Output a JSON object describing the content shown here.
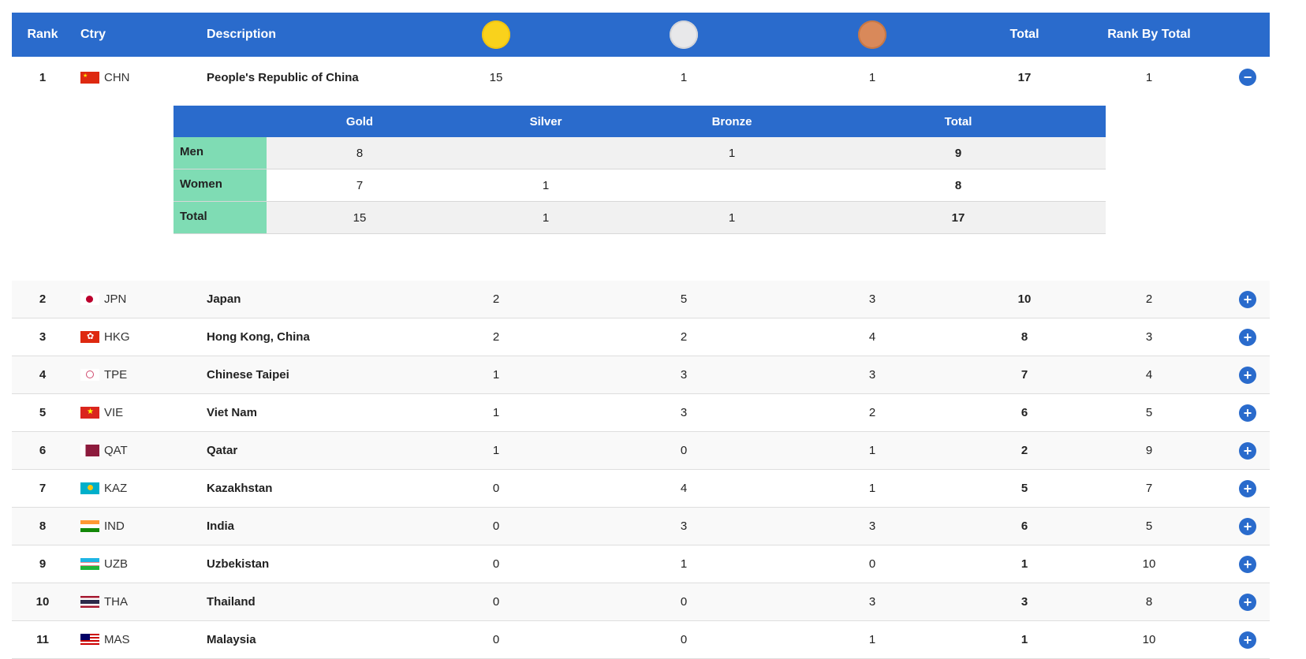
{
  "header": {
    "rank": "Rank",
    "ctry": "Ctry",
    "description": "Description",
    "total": "Total",
    "rank_by_total": "Rank By Total"
  },
  "sub_header": {
    "gold": "Gold",
    "silver": "Silver",
    "bronze": "Bronze",
    "total": "Total"
  },
  "first": {
    "rank": "1",
    "code": "CHN",
    "name": "People's Republic of China",
    "gold": "15",
    "silver": "1",
    "bronze": "1",
    "total": "17",
    "rank_by_total": "1",
    "breakdown": [
      {
        "label": "Men",
        "gold": "8",
        "silver": "",
        "bronze": "1",
        "total": "9"
      },
      {
        "label": "Women",
        "gold": "7",
        "silver": "1",
        "bronze": "",
        "total": "8"
      },
      {
        "label": "Total",
        "gold": "15",
        "silver": "1",
        "bronze": "1",
        "total": "17"
      }
    ]
  },
  "rows": [
    {
      "rank": "2",
      "code": "JPN",
      "name": "Japan",
      "gold": "2",
      "silver": "5",
      "bronze": "3",
      "total": "10",
      "rank_by_total": "2"
    },
    {
      "rank": "3",
      "code": "HKG",
      "name": "Hong Kong, China",
      "gold": "2",
      "silver": "2",
      "bronze": "4",
      "total": "8",
      "rank_by_total": "3"
    },
    {
      "rank": "4",
      "code": "TPE",
      "name": "Chinese Taipei",
      "gold": "1",
      "silver": "3",
      "bronze": "3",
      "total": "7",
      "rank_by_total": "4"
    },
    {
      "rank": "5",
      "code": "VIE",
      "name": "Viet Nam",
      "gold": "1",
      "silver": "3",
      "bronze": "2",
      "total": "6",
      "rank_by_total": "5"
    },
    {
      "rank": "6",
      "code": "QAT",
      "name": "Qatar",
      "gold": "1",
      "silver": "0",
      "bronze": "1",
      "total": "2",
      "rank_by_total": "9"
    },
    {
      "rank": "7",
      "code": "KAZ",
      "name": "Kazakhstan",
      "gold": "0",
      "silver": "4",
      "bronze": "1",
      "total": "5",
      "rank_by_total": "7"
    },
    {
      "rank": "8",
      "code": "IND",
      "name": "India",
      "gold": "0",
      "silver": "3",
      "bronze": "3",
      "total": "6",
      "rank_by_total": "5"
    },
    {
      "rank": "9",
      "code": "UZB",
      "name": "Uzbekistan",
      "gold": "0",
      "silver": "1",
      "bronze": "0",
      "total": "1",
      "rank_by_total": "10"
    },
    {
      "rank": "10",
      "code": "THA",
      "name": "Thailand",
      "gold": "0",
      "silver": "0",
      "bronze": "3",
      "total": "3",
      "rank_by_total": "8"
    },
    {
      "rank": "11",
      "code": "MAS",
      "name": "Malaysia",
      "gold": "0",
      "silver": "0",
      "bronze": "1",
      "total": "1",
      "rank_by_total": "10"
    }
  ],
  "icons": {
    "collapse": "minus-circle-icon",
    "expand": "plus-circle-icon"
  },
  "colors": {
    "header_bg": "#2a6bcc",
    "label_green": "#7fdcb4",
    "gold": "#f9d21c",
    "silver": "#e8e8ea",
    "bronze": "#d9895a"
  }
}
